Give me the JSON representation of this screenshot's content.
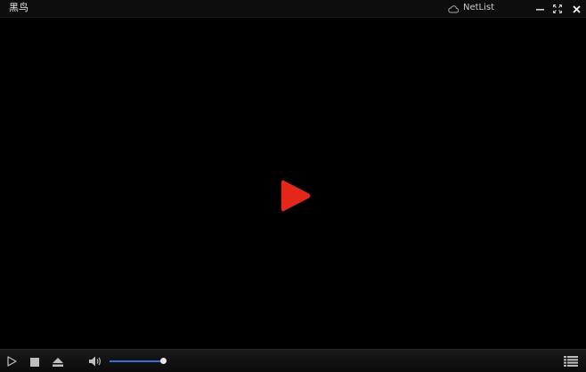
{
  "window": {
    "title": "黑鸟",
    "netlist_label": "NetList"
  },
  "icons": {
    "cloud": "cloud-icon",
    "minimize": "minimize-icon",
    "fullscreen": "fullscreen-icon",
    "close": "close-icon",
    "big_play": "play-icon",
    "play": "play-icon",
    "stop": "stop-icon",
    "eject": "eject-icon",
    "volume": "volume-icon",
    "playlist": "playlist-icon"
  },
  "controls": {
    "volume_level": 1.0
  },
  "colors": {
    "background": "#000000",
    "accent_play": "#e3281b",
    "volume_fill": "#3b6fd6"
  }
}
